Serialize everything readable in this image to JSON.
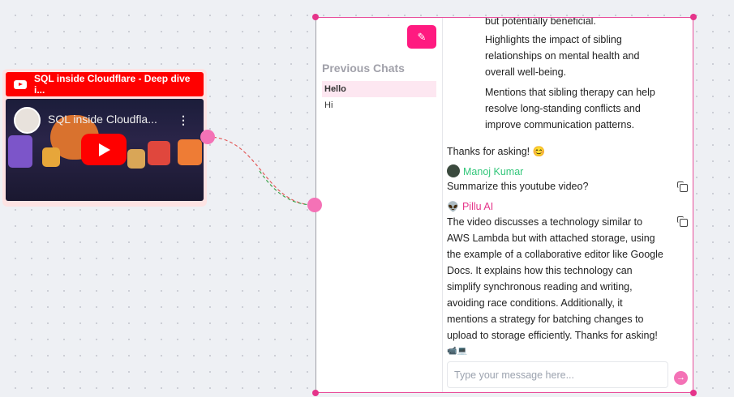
{
  "video_node": {
    "header_title": "SQL inside Cloudflare - Deep dive i...",
    "video_title": "SQL inside Cloudfla...",
    "icon": "youtube-icon"
  },
  "sidebar": {
    "title": "Previous Chats",
    "chats": [
      {
        "label": "Hello",
        "active": true
      },
      {
        "label": "Hi",
        "active": false
      }
    ]
  },
  "messages": {
    "prev_lines": [
      "but potentially beneficial.",
      "Highlights the impact of sibling",
      "relationships on mental health and",
      "overall well-being.",
      "Mentions that sibling therapy can help",
      "resolve long-standing conflicts and",
      "improve communication patterns."
    ],
    "prev_end": "Thanks for asking! 😊",
    "user": {
      "name": "Manoj Kumar",
      "text": "Summarize this youtube video?"
    },
    "ai": {
      "name": "Pillu AI",
      "avatar": "👽",
      "lines": [
        "The video discusses a technology similar to",
        "AWS Lambda but with attached storage, using",
        "the example of a collaborative editor like Google",
        "Docs. It explains how this technology can",
        "simplify synchronous reading and writing,",
        "avoiding race conditions. Additionally, it",
        "mentions a strategy for batching changes to",
        "upload to storage efficiently. Thanks for asking!"
      ],
      "emoji": "📹💻"
    }
  },
  "input": {
    "placeholder": "Type your message here...",
    "send": "→"
  },
  "colors": {
    "accent": "#ff1a80",
    "user_name": "#34c77b",
    "ai_name": "#e5348a"
  }
}
